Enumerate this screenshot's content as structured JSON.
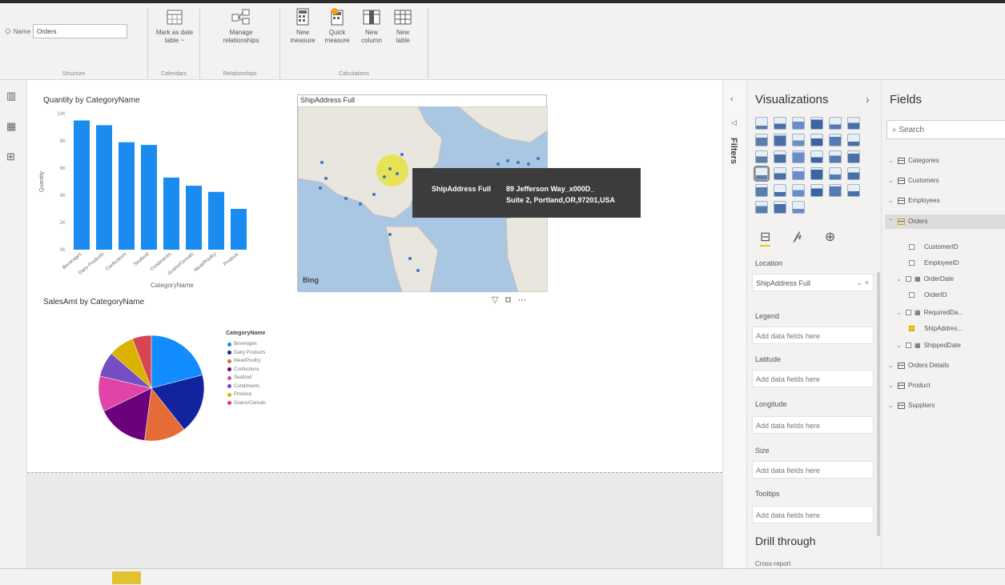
{
  "ribbon": {
    "name_label": "Name",
    "name_value": "Orders",
    "structure_label": "Structure",
    "mark_date_line1": "Mark as date",
    "mark_date_line2": "table ~",
    "calendars_label": "Calendars",
    "manage_rel_line1": "Manage",
    "manage_rel_line2": "relationships",
    "relationships_label": "Relationships",
    "new_measure_line1": "New",
    "new_measure_line2": "measure",
    "quick_measure_line1": "Quick",
    "quick_measure_line2": "measure",
    "new_column_line1": "New",
    "new_column_line2": "column",
    "new_table_line1": "New",
    "new_table_line2": "table",
    "calculations_label": "Calculations"
  },
  "bar_chart": {
    "title": "Quantity by CategoryName",
    "ylabel": "Quantity",
    "xlabel": "CategoryName",
    "color": "#1a8cf0"
  },
  "map": {
    "title": "ShipAddress Full",
    "bing_label": "Bing"
  },
  "tooltip": {
    "key": "ShipAddress Full",
    "value_line1": "89 Jefferson Way_x000D_",
    "value_line2": "Suite 2, Portland,OR,97201,USA"
  },
  "pie": {
    "title": "SalesAmt by CategoryName",
    "legend_title": "CategoryName"
  },
  "chart_data": [
    {
      "type": "bar",
      "title": "Quantity by CategoryName",
      "xlabel": "CategoryName",
      "ylabel": "Quantity",
      "categories": [
        "Beverages",
        "Dairy Products",
        "Confections",
        "Seafood",
        "Condiments",
        "Grains/Cereals",
        "Meat/Poultry",
        "Produce"
      ],
      "values": [
        9500,
        9150,
        7900,
        7700,
        5300,
        4700,
        4250,
        3000
      ],
      "ylim": [
        0,
        10000
      ],
      "yticks": [
        "0K",
        "2K",
        "4K",
        "6K",
        "8K",
        "10K"
      ]
    },
    {
      "type": "pie",
      "title": "SalesAmt by CategoryName",
      "legend_title": "CategoryName",
      "categories": [
        "Beverages",
        "Dairy Products",
        "Meat/Poultry",
        "Confections",
        "Seafood",
        "Condiments",
        "Produce",
        "Grains/Cereals"
      ],
      "values": [
        21.19,
        18.5,
        12.9,
        15.89,
        10.98,
        7.77,
        7.89,
        5.88
      ],
      "colors": [
        "#118dff",
        "#12239e",
        "#e66c37",
        "#6b007b",
        "#e044a7",
        "#744ec2",
        "#d9b300",
        "#d64550"
      ]
    }
  ],
  "panes": {
    "filters_label": "Filters",
    "viz_title": "Visualizations",
    "location_label": "Location",
    "location_value": "ShipAddress Full",
    "legend_label": "Legend",
    "latitude_label": "Latitude",
    "longitude_label": "Longitude",
    "size_label": "Size",
    "tooltips_label": "Tooltips",
    "add_fields": "Add data fields here",
    "drill_title": "Drill through",
    "cross_report": "Cross-report"
  },
  "fields": {
    "title": "Fields",
    "search_placeholder": "Search",
    "tables": [
      "Categories",
      "Customers",
      "Employees",
      "Orders"
    ],
    "order_fields": [
      "CustomerID",
      "EmployeeID",
      "OrderDate",
      "OrderID",
      "RequiredDa...",
      "ShipAddres...",
      "ShippedDate"
    ],
    "more_tables": [
      "Orders Details",
      "Product",
      "Suppliers"
    ]
  }
}
